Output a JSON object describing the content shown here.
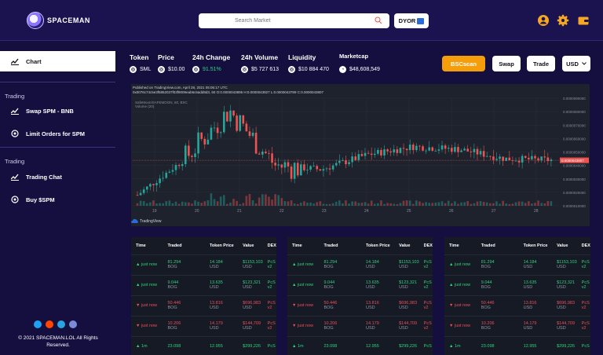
{
  "header": {
    "brand": "SPACEMAN",
    "search_placeholder": "Search Market",
    "dyor": "DYOR"
  },
  "sidebar": {
    "items": [
      {
        "label": "Chart"
      },
      {
        "label": "Swap SPM - BNB"
      },
      {
        "label": "Limit Orders for SPM"
      },
      {
        "label": "Trading Chat"
      },
      {
        "label": "Buy $SPM"
      }
    ],
    "section1": "Trading",
    "section2": "Trading",
    "copyright": "© 2021 SPACEMAN.LOL  All Rights Reserved."
  },
  "stats": {
    "token_label": "Token",
    "token": "SML",
    "price_label": "Price",
    "price": "$10.00",
    "change_label": "24h Change",
    "change": "91.51%",
    "volume_label": "24h Volume",
    "volume": "$5 727 613",
    "liquidity_label": "Liquidity",
    "liquidity": "$10 884 470",
    "marketcap_label": "Marketcap",
    "marketcap": "$48,608,549"
  },
  "actions": {
    "bscscan": "BSCscan",
    "swap": "Swap",
    "trade": "Trade",
    "currency": "USD"
  },
  "chart": {
    "published": "Published on TradingView.com, April 28, 2021 05:06:17 UTC",
    "ohlc": "0x0076c74c5e3f5852037f03f9009eab6c6add8d3, 60  O:0.0000043895 H:0.0000043927 L:0.0000043789 C:0.0000043807",
    "pair": "SafeMoon/SAFEMOON, 60, BSC",
    "volume_label": "Volume (20)",
    "price_tag": "0.0000043807",
    "tv_label": "TradingView",
    "yticks": [
      "0.0000090000",
      "0.0000080000",
      "0.0000070000",
      "0.0000060000",
      "0.0000050000",
      "0.0000040000",
      "0.0000030000",
      "0.0000020000",
      "0.0000010000"
    ],
    "xticks": [
      "19",
      "20",
      "21",
      "22",
      "23",
      "24",
      "25",
      "26",
      "27",
      "28"
    ]
  },
  "chart_data": {
    "type": "candlestick",
    "x": [
      "19",
      "20",
      "21",
      "22",
      "23",
      "24",
      "25",
      "26",
      "27",
      "28"
    ],
    "close": [
      1.8e-06,
      4.4e-06,
      8.1e-06,
      4e-06,
      3.7e-06,
      4.8e-06,
      5.4e-06,
      5.2e-06,
      4.5e-06,
      4.4e-06
    ]
  },
  "trade_tables": [
    {
      "headers": [
        "Time",
        "Traded",
        "Token Price",
        "Value",
        "DEX"
      ],
      "rows": [
        {
          "dir": "up",
          "time": "just now",
          "traded": "81.294",
          "traded_unit": "BOG",
          "price": "14.184",
          "price_unit": "USD",
          "value": "$1153,103",
          "value_unit": "USD",
          "dex": "PcS v2"
        },
        {
          "dir": "up",
          "time": "just now",
          "traded": "9.044",
          "traded_unit": "BOG",
          "price": "13.635",
          "price_unit": "USD",
          "value": "$123,321",
          "value_unit": "USD",
          "dex": "PcS v2"
        },
        {
          "dir": "down",
          "time": "just now",
          "traded": "50.446",
          "traded_unit": "BOG",
          "price": "13.816",
          "price_unit": "USD",
          "value": "$696,983",
          "value_unit": "USD",
          "dex": "PcS v2"
        },
        {
          "dir": "down",
          "time": "just now",
          "traded": "10.206",
          "traded_unit": "BOG",
          "price": "14.179",
          "price_unit": "USD",
          "value": "$144,709",
          "value_unit": "USD",
          "dex": "PcS v2"
        },
        {
          "dir": "up",
          "time": "1m",
          "traded": "23.098",
          "traded_unit": "",
          "price": "12.955",
          "price_unit": "",
          "value": "$299,226",
          "value_unit": "",
          "dex": "PcS"
        }
      ]
    },
    {
      "headers": [
        "Time",
        "Traded",
        "Token Price",
        "Value",
        "DEX"
      ],
      "rows": [
        {
          "dir": "up",
          "time": "just now",
          "traded": "81.294",
          "traded_unit": "BOG",
          "price": "14.184",
          "price_unit": "USD",
          "value": "$1153,103",
          "value_unit": "USD",
          "dex": "PcS v2"
        },
        {
          "dir": "up",
          "time": "just now",
          "traded": "9.044",
          "traded_unit": "BOG",
          "price": "13.635",
          "price_unit": "USD",
          "value": "$123,321",
          "value_unit": "USD",
          "dex": "PcS v2"
        },
        {
          "dir": "down",
          "time": "just now",
          "traded": "50.446",
          "traded_unit": "BOG",
          "price": "13.816",
          "price_unit": "USD",
          "value": "$696,983",
          "value_unit": "USD",
          "dex": "PcS v2"
        },
        {
          "dir": "down",
          "time": "just now",
          "traded": "10.206",
          "traded_unit": "BOG",
          "price": "14.179",
          "price_unit": "USD",
          "value": "$144,709",
          "value_unit": "USD",
          "dex": "PcS v2"
        },
        {
          "dir": "up",
          "time": "1m",
          "traded": "23.098",
          "traded_unit": "",
          "price": "12.955",
          "price_unit": "",
          "value": "$299,226",
          "value_unit": "",
          "dex": "PcS"
        }
      ]
    },
    {
      "headers": [
        "Time",
        "Traded",
        "Token Price",
        "Value",
        "DEX"
      ],
      "rows": [
        {
          "dir": "up",
          "time": "just now",
          "traded": "81.294",
          "traded_unit": "BOG",
          "price": "14.184",
          "price_unit": "USD",
          "value": "$1153,103",
          "value_unit": "USD",
          "dex": "PcS v2"
        },
        {
          "dir": "up",
          "time": "just now",
          "traded": "9.044",
          "traded_unit": "BOG",
          "price": "13.635",
          "price_unit": "USD",
          "value": "$123,321",
          "value_unit": "USD",
          "dex": "PcS v2"
        },
        {
          "dir": "down",
          "time": "just now",
          "traded": "50.446",
          "traded_unit": "BOG",
          "price": "13.816",
          "price_unit": "USD",
          "value": "$696,983",
          "value_unit": "USD",
          "dex": "PcS v2"
        },
        {
          "dir": "down",
          "time": "just now",
          "traded": "10.206",
          "traded_unit": "BOG",
          "price": "14.179",
          "price_unit": "USD",
          "value": "$144,709",
          "value_unit": "USD",
          "dex": "PcS v2"
        },
        {
          "dir": "up",
          "time": "1m",
          "traded": "23.098",
          "traded_unit": "",
          "price": "12.955",
          "price_unit": "",
          "value": "$299,226",
          "value_unit": "",
          "dex": "PcS"
        }
      ]
    }
  ],
  "colors": {
    "bg": "#150f40",
    "accent": "#f59e0b",
    "up": "#2fd47e",
    "down": "#f04d5a"
  }
}
